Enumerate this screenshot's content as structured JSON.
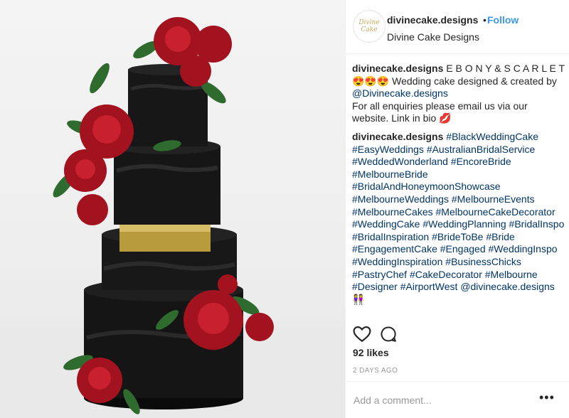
{
  "post": {
    "image_alt": "Black four-tier wedding cake with red roses",
    "username": "divinecake.designs",
    "separator": "•",
    "follow_label": "Follow",
    "full_name": "Divine Cake Designs",
    "avatar_text": "Divine Cake"
  },
  "caption": {
    "username": "divinecake.designs",
    "line1": "E B O N Y & S C A R L E T",
    "emojis": "😍😍😍",
    "text_a": " Wedding cake designed & created by ",
    "mention": "@Divinecake.designs",
    "text_b": "For all enquiries please email us via our website. Link in bio",
    "emoji_kiss": "💋"
  },
  "hashtags_comment": {
    "username": "divinecake.designs",
    "tags": [
      "#BlackWeddingCake",
      "#EasyWeddings",
      "#AustralianBridalService",
      "#WeddedWonderland",
      "#EncoreBride",
      "#MelbourneBride",
      "#BridalAndHoneymoonShowcase",
      "#MelbourneWeddings",
      "#MelbourneEvents",
      "#MelbourneCakes",
      "#MelbourneCakeDecorator",
      "#WeddingCake",
      "#WeddingPlanning",
      "#BridalInspo",
      "#BridalInspiration",
      "#BrideToBe",
      "#Bride",
      "#EngagementCake",
      "#Engaged",
      "#WeddingInspo",
      "#WeddingInspiration",
      "#BusinessChicks",
      "#PastryChef",
      "#CakeDecorator",
      "#Melbourne",
      "#Designer",
      "#AirportWest"
    ],
    "mention": "@divinecake.designs",
    "emoji_end": "👭"
  },
  "stats": {
    "likes": "92 likes",
    "date": "2 DAYS AGO"
  },
  "comment_box": {
    "placeholder": "Add a comment...",
    "more": "•••"
  },
  "icons": [
    "heart-icon",
    "comment-icon",
    "more-options-icon"
  ],
  "colors": {
    "link": "#3897f0",
    "hashtag": "#003569",
    "text": "#262626",
    "muted": "#999999"
  }
}
